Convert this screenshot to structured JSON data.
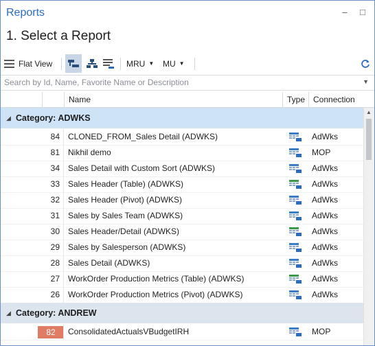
{
  "window": {
    "title": "Reports",
    "minimize_label": "–",
    "maximize_label": "□"
  },
  "heading": "1. Select a Report",
  "toolbar": {
    "flat_view_label": "Flat View",
    "mru_label": "MRU",
    "mu_label": "MU",
    "dropdown_arrow": "▼"
  },
  "search": {
    "placeholder": "Search by Id, Name, Favorite Name or Description",
    "value": ""
  },
  "columns": {
    "name": "Name",
    "type": "Type",
    "connection": "Connection"
  },
  "categories": [
    {
      "label": "Category: ADWKS",
      "rows": [
        {
          "id": "84",
          "name": "CLONED_FROM_Sales Detail (ADWKS)",
          "type": "blue",
          "connection": "AdWks"
        },
        {
          "id": "81",
          "name": "Nikhil demo",
          "type": "blue",
          "connection": "MOP"
        },
        {
          "id": "34",
          "name": "Sales Detail with Custom Sort (ADWKS)",
          "type": "blue",
          "connection": "AdWks"
        },
        {
          "id": "33",
          "name": "Sales Header (Table) (ADWKS)",
          "type": "green",
          "connection": "AdWks"
        },
        {
          "id": "32",
          "name": "Sales Header (Pivot) (ADWKS)",
          "type": "blue",
          "connection": "AdWks"
        },
        {
          "id": "31",
          "name": "Sales by Sales Team (ADWKS)",
          "type": "blue",
          "connection": "AdWks"
        },
        {
          "id": "30",
          "name": "Sales Header/Detail (ADWKS)",
          "type": "green",
          "connection": "AdWks"
        },
        {
          "id": "29",
          "name": "Sales by Salesperson (ADWKS)",
          "type": "blue",
          "connection": "AdWks"
        },
        {
          "id": "28",
          "name": "Sales Detail (ADWKS)",
          "type": "blue",
          "connection": "AdWks"
        },
        {
          "id": "27",
          "name": "WorkOrder Production Metrics (Table) (ADWKS)",
          "type": "green",
          "connection": "AdWks"
        },
        {
          "id": "26",
          "name": "WorkOrder Production Metrics (Pivot) (ADWKS)",
          "type": "blue",
          "connection": "AdWks"
        }
      ]
    },
    {
      "label": "Category: ANDREW",
      "rows": [
        {
          "id": "82",
          "name": "ConsolidatedActualsVBudgetIRH",
          "type": "blue",
          "connection": "MOP",
          "highlight": true
        }
      ]
    }
  ],
  "colors": {
    "accent": "#2b6cc4",
    "category_bg": "#dce5ee",
    "selected_category_bg": "#cfe3f7",
    "id_highlight": "#e07b64"
  }
}
